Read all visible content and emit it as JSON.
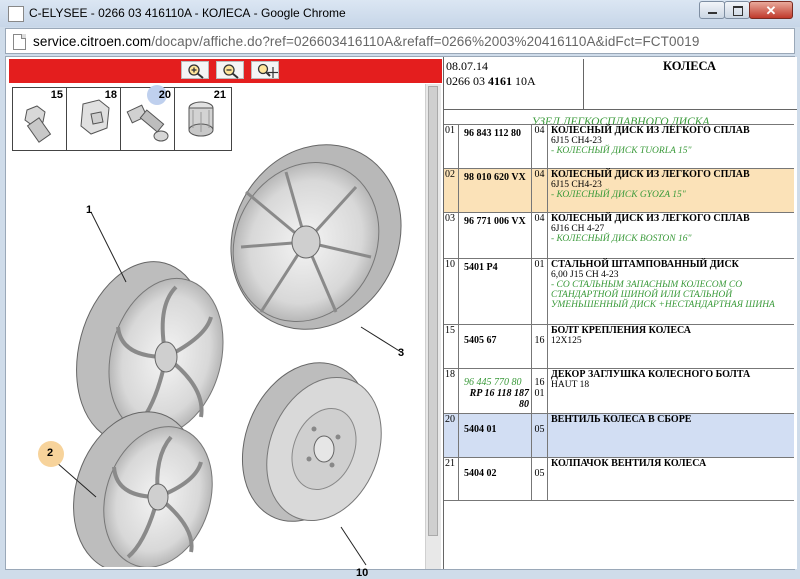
{
  "window": {
    "title": "C-ELYSEE - 0266 03 416110A - КОЛЕСА - Google Chrome",
    "minimize_label": "",
    "maximize_label": "",
    "close_label": "✕"
  },
  "address_bar": {
    "url_host": "service.citroen.com",
    "url_path": "/docapv/affiche.do?ref=026603416110A&refaff=0266%2003%20416110A&idFct=FCT0019"
  },
  "viewer": {
    "tools": [
      {
        "name": "zoom-in"
      },
      {
        "name": "zoom-out"
      },
      {
        "name": "zoom-fit"
      }
    ],
    "strip_parts": [
      {
        "num": "15",
        "label": "bolt"
      },
      {
        "num": "18",
        "label": "bolt-cap"
      },
      {
        "num": "20",
        "label": "valve",
        "highlighted": true
      },
      {
        "num": "21",
        "label": "valve-cap"
      }
    ],
    "callouts": [
      {
        "num": "1"
      },
      {
        "num": "2",
        "highlighted": true
      },
      {
        "num": "3"
      },
      {
        "num": "10"
      }
    ]
  },
  "header": {
    "date": "08.07.14",
    "ref_prefix": "0266 03 ",
    "ref_bold": "4161",
    "ref_suffix": " 10A",
    "title": "КОЛЕСА"
  },
  "group_title": "УЗЕЛ ЛЕГКОСПЛАВНОГО ДИСКА",
  "rows": [
    {
      "n": "01",
      "ref": "96 843 112 80",
      "qty": "04",
      "title": "КОЛЕСНЫЙ ДИСК ИЗ ЛЕГКОГО СПЛАВ",
      "sub": "6J15 CH4-23",
      "note": "- КОЛЕСНЫЙ ДИСК TUORLA 15\"",
      "state": ""
    },
    {
      "n": "02",
      "ref": "98 010 620 VX",
      "qty": "04",
      "title": "КОЛЕСНЫЙ ДИСК ИЗ ЛЕГКОГО СПЛАВ",
      "sub": "6J15 CH4-23",
      "note": "- КОЛЕСНЫЙ ДИСК GYOZA 15\"",
      "state": "sel"
    },
    {
      "n": "03",
      "ref": "96 771 006 VX",
      "qty": "04",
      "title": "КОЛЕСНЫЙ ДИСК ИЗ ЛЕГКОГО СПЛАВ",
      "sub": "6J16 CH 4-27",
      "note": "- КОЛЕСНЫЙ ДИСК BOSTON 16\"",
      "state": ""
    },
    {
      "n": "10",
      "ref": "5401 P4",
      "qty": "01",
      "title": "СТАЛЬНОЙ ШТАМПОВАННЫЙ ДИСК",
      "sub": "6,00 J15 CH 4-23",
      "note": "- СО СТАЛЬНЫМ ЗАПАСНЫМ КОЛЕСОМ СО СТАНДАРТНОЙ ШИНОЙ ИЛИ СТАЛЬНОЙ УМЕНЬШЕННЫЙ ДИСК +НЕСТАНДАРТНАЯ ШИНА",
      "state": ""
    },
    {
      "n": "15",
      "ref": "5405 67",
      "qty": "16",
      "title": "БОЛТ КРЕПЛЕНИЯ КОЛЕСА",
      "sub": "12X125",
      "note": "",
      "state": ""
    },
    {
      "n": "18",
      "ref": "96 445 770 80",
      "ref2": "RP 16 118 187 80",
      "qty": "16",
      "qty2": "01",
      "title": "ДЕКОР ЗАГЛУШКА КОЛЕСНОГО БОЛТА",
      "sub": "HAUT 18",
      "note": "",
      "state": ""
    },
    {
      "n": "20",
      "ref": "5404 01",
      "qty": "05",
      "title": "ВЕНТИЛЬ КОЛЕСА В СБОРЕ",
      "sub": "",
      "note": "",
      "state": "blue"
    },
    {
      "n": "21",
      "ref": "5404 02",
      "qty": "05",
      "title": "КОЛПАЧОК ВЕНТИЛЯ КОЛЕСА",
      "sub": "",
      "note": "",
      "state": ""
    }
  ]
}
